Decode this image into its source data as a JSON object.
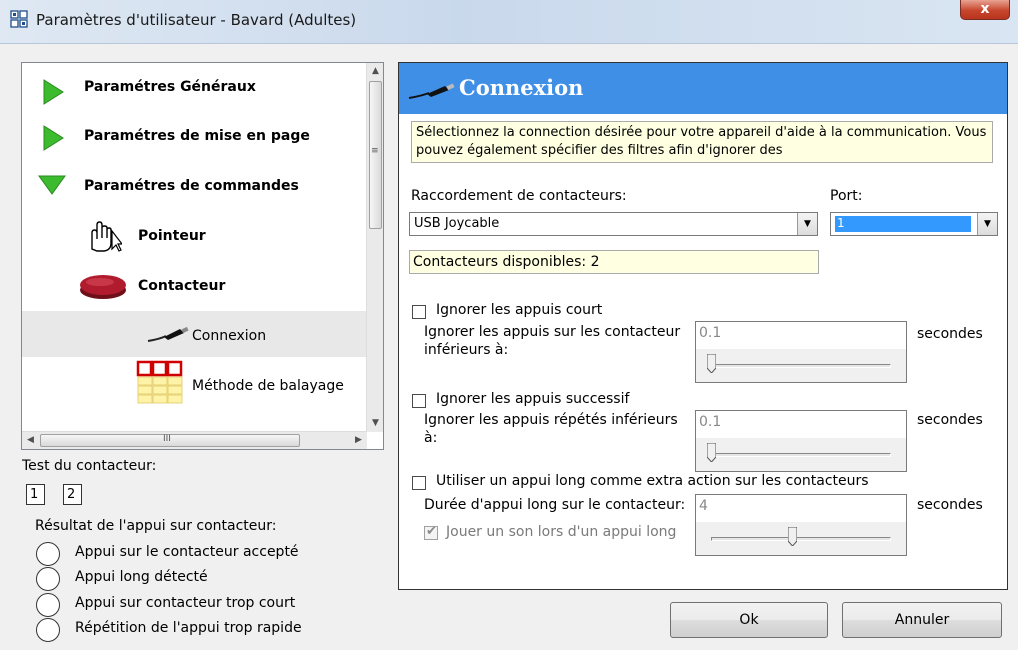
{
  "window": {
    "title": "Paramètres d'utilisateur - Bavard (Adultes)",
    "close_label": "x"
  },
  "tree": {
    "items": [
      {
        "label": "Paramétres Généraux",
        "icon": "green-arrow-right-icon"
      },
      {
        "label": "Paramétres de mise en page",
        "icon": "green-arrow-right-icon"
      },
      {
        "label": "Paramétres de commandes",
        "icon": "green-arrow-down-icon"
      },
      {
        "label": "Pointeur",
        "icon": "hand-pointer-icon"
      },
      {
        "label": "Contacteur",
        "icon": "red-switch-button-icon"
      },
      {
        "label": "Connexion",
        "icon": "cable-plug-icon"
      },
      {
        "label": "Méthode de balayage",
        "icon": "scan-grid-icon"
      }
    ],
    "selected_index": 5,
    "hscroll_grip": "III"
  },
  "switch_test": {
    "label": "Test du contacteur:",
    "boxes": [
      "1",
      "2"
    ]
  },
  "result": {
    "label": "Résultat de l'appui sur contacteur:",
    "items": [
      "Appui sur le contacteur accepté",
      "Appui long détecté",
      "Appui sur contacteur trop court",
      "Répétition de l'appui trop rapide"
    ]
  },
  "panel": {
    "title": "Connexion",
    "header_color": "#3f8fe6",
    "description": "Sélectionnez la connection désirée pour votre appareil d'aide à la communication. Vous pouvez également spécifier des filtres afin d'ignorer des",
    "connection_label": "Raccordement de contacteurs:",
    "connection_value": "USB Joycable",
    "port_label": "Port:",
    "port_value": "1",
    "available": "Contacteurs disponibles: 2",
    "short_press": {
      "checkbox_label": "Ignorer les appuis court",
      "checked": false,
      "field_label_1": "Ignorer les appuis sur les contacteur",
      "field_label_2": "inférieurs à:",
      "value": "0.1",
      "slider_fraction": 0.0,
      "unit": "secondes"
    },
    "repeat_press": {
      "checkbox_label": "Ignorer les appuis successif",
      "checked": false,
      "field_label_1": "Ignorer les appuis répétés inférieurs",
      "field_label_2": "à:",
      "value": "0.1",
      "slider_fraction": 0.0,
      "unit": "secondes"
    },
    "long_press": {
      "checkbox_label": "Utiliser un appui long comme extra action sur les contacteurs",
      "checked": false,
      "field_label": "Durée d'appui long sur le contacteur:",
      "value": "4",
      "slider_fraction": 0.45,
      "unit": "secondes",
      "sound_label": "Jouer un son lors d'un appui long",
      "sound_checked": true
    }
  },
  "buttons": {
    "ok": "Ok",
    "cancel": "Annuler"
  }
}
